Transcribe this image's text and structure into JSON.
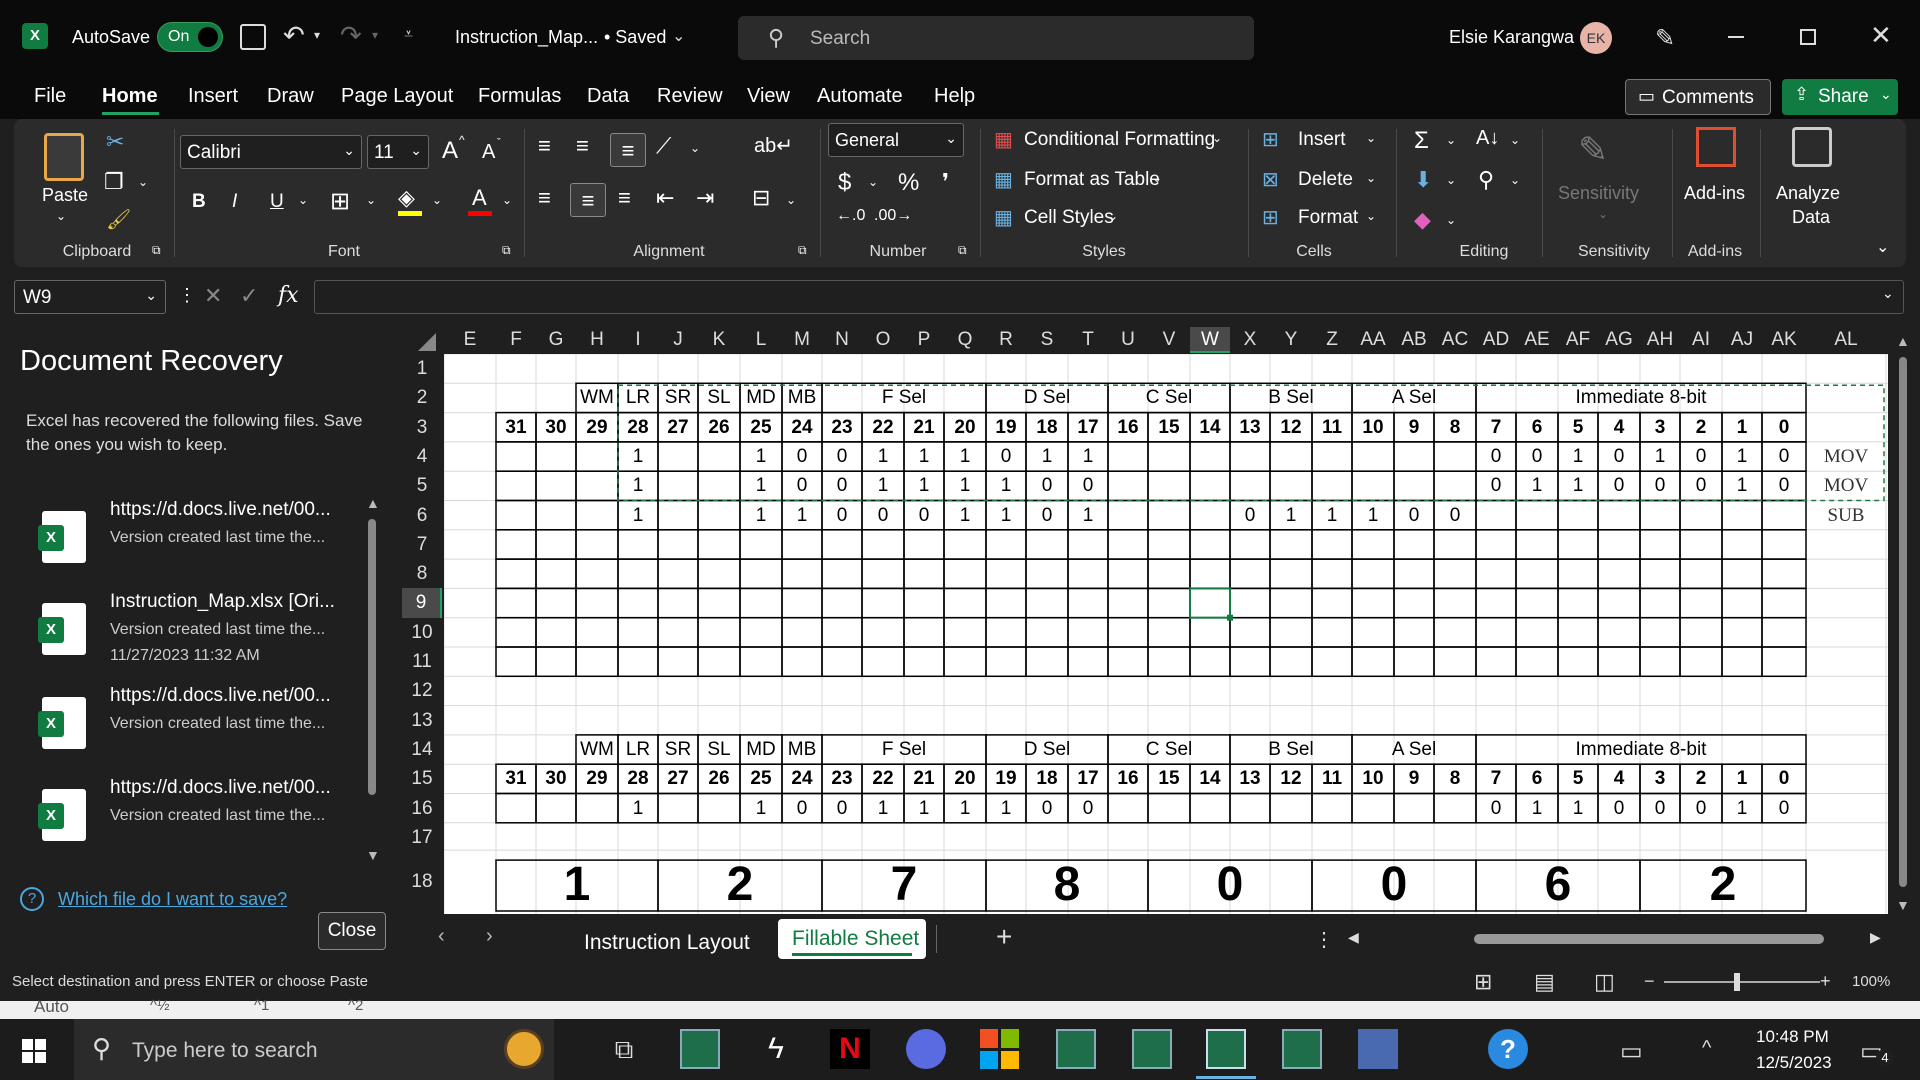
{
  "titlebar": {
    "autosave_label": "AutoSave",
    "autosave_state": "On",
    "filename": "Instruction_Map...",
    "saved_status": "• Saved",
    "search_placeholder": "Search",
    "user_name": "Elsie Karangwa",
    "user_initials": "EK"
  },
  "menu": [
    "File",
    "Home",
    "Insert",
    "Draw",
    "Page Layout",
    "Formulas",
    "Data",
    "Review",
    "View",
    "Automate",
    "Help"
  ],
  "menu_active": "Home",
  "actions": {
    "comments": "Comments",
    "share": "Share"
  },
  "ribbon": {
    "clipboard": {
      "paste": "Paste",
      "label": "Clipboard"
    },
    "font": {
      "name": "Calibri",
      "size": "11",
      "label": "Font",
      "bold": "B",
      "italic": "I",
      "underline": "U",
      "grow": "A",
      "shrink": "A"
    },
    "alignment": {
      "label": "Alignment"
    },
    "number": {
      "format": "General",
      "label": "Number",
      "currency": "$",
      "percent": "%",
      "comma": "❜"
    },
    "styles": {
      "conditional": "Conditional Formatting",
      "table": "Format as Table",
      "cell": "Cell Styles",
      "label": "Styles"
    },
    "cells": {
      "insert": "Insert",
      "delete": "Delete",
      "format": "Format",
      "label": "Cells"
    },
    "editing": {
      "label": "Editing"
    },
    "sensitivity": {
      "button": "Sensitivity",
      "label": "Sensitivity"
    },
    "addins": {
      "button": "Add-ins",
      "label": "Add-ins"
    },
    "analyze": {
      "line1": "Analyze",
      "line2": "Data"
    }
  },
  "formula_bar": {
    "name_box": "W9",
    "fx": "fx",
    "content": ""
  },
  "recovery": {
    "title": "Document Recovery",
    "description": "Excel has recovered the following files.  Save the ones you wish to keep.",
    "items": [
      {
        "title": "https://d.docs.live.net/00...",
        "sub": "Version created last time the...",
        "date": ""
      },
      {
        "title": "Instruction_Map.xlsx  [Ori...",
        "sub": "Version created last time the...",
        "date": "11/27/2023 11:32 AM"
      },
      {
        "title": "https://d.docs.live.net/00...",
        "sub": "Version created last time the...",
        "date": ""
      },
      {
        "title": "https://d.docs.live.net/00...",
        "sub": "Version created last time the...",
        "date": ""
      }
    ],
    "help_link": "Which file do I want to save?",
    "close": "Close"
  },
  "sheet": {
    "columns": [
      "E",
      "F",
      "G",
      "H",
      "I",
      "J",
      "K",
      "L",
      "M",
      "N",
      "O",
      "P",
      "Q",
      "R",
      "S",
      "T",
      "U",
      "V",
      "W",
      "X",
      "Y",
      "Z",
      "AA",
      "AB",
      "AC",
      "AD",
      "AE",
      "AF",
      "AG",
      "AH",
      "AI",
      "AJ",
      "AK",
      "AL"
    ],
    "rows": [
      "1",
      "2",
      "3",
      "4",
      "5",
      "6",
      "7",
      "8",
      "9",
      "10",
      "11",
      "12",
      "13",
      "14",
      "15",
      "16",
      "17",
      "18"
    ],
    "field_headers": [
      "WM",
      "LR",
      "SR",
      "SL",
      "MD",
      "MB",
      "F Sel",
      "D Sel",
      "C Sel",
      "B Sel",
      "A Sel",
      "Immediate 8-bit"
    ],
    "bit_numbers": [
      "31",
      "30",
      "29",
      "28",
      "27",
      "26",
      "25",
      "24",
      "23",
      "22",
      "21",
      "20",
      "19",
      "18",
      "17",
      "16",
      "15",
      "14",
      "13",
      "12",
      "11",
      "10",
      "9",
      "8",
      "7",
      "6",
      "5",
      "4",
      "3",
      "2",
      "1",
      "0"
    ],
    "row4": [
      "",
      "",
      "",
      "1",
      "",
      "",
      "1",
      "0",
      "0",
      "1",
      "1",
      "1",
      "0",
      "1",
      "1",
      "",
      "",
      "",
      "",
      "",
      "",
      "",
      "",
      "",
      "0",
      "0",
      "1",
      "0",
      "1",
      "0",
      "1",
      "0"
    ],
    "row5": [
      "",
      "",
      "",
      "1",
      "",
      "",
      "1",
      "0",
      "0",
      "1",
      "1",
      "1",
      "1",
      "0",
      "0",
      "",
      "",
      "",
      "",
      "",
      "",
      "",
      "",
      "",
      "0",
      "1",
      "1",
      "0",
      "0",
      "0",
      "1",
      "0"
    ],
    "row6": [
      "",
      "",
      "",
      "1",
      "",
      "",
      "1",
      "1",
      "0",
      "0",
      "0",
      "1",
      "1",
      "0",
      "1",
      "",
      "",
      "",
      "0",
      "1",
      "1",
      "1",
      "0",
      "0",
      "",
      "",
      "",
      "",
      "",
      "",
      "",
      ""
    ],
    "row16": [
      "",
      "",
      "",
      "1",
      "",
      "",
      "1",
      "0",
      "0",
      "1",
      "1",
      "1",
      "1",
      "0",
      "0",
      "",
      "",
      "",
      "",
      "",
      "",
      "",
      "",
      "",
      "0",
      "1",
      "1",
      "0",
      "0",
      "0",
      "1",
      "0"
    ],
    "ops": [
      "MOV",
      "MOV",
      "SUB"
    ],
    "hex_digits": [
      "1",
      "2",
      "7",
      "8",
      "0",
      "0",
      "6",
      "2"
    ]
  },
  "tabs": [
    "Instruction Layout",
    "Fillable Sheet"
  ],
  "active_tab": "Fillable Sheet",
  "status": {
    "message": "Select destination and press ENTER or choose Paste",
    "zoom": "100%"
  },
  "strip_cells": [
    "Auto",
    "^½",
    "^1",
    "^2"
  ],
  "taskbar": {
    "search_placeholder": "Type here to search",
    "time": "10:48 PM",
    "date": "12/5/2023",
    "notif_count": "4"
  }
}
